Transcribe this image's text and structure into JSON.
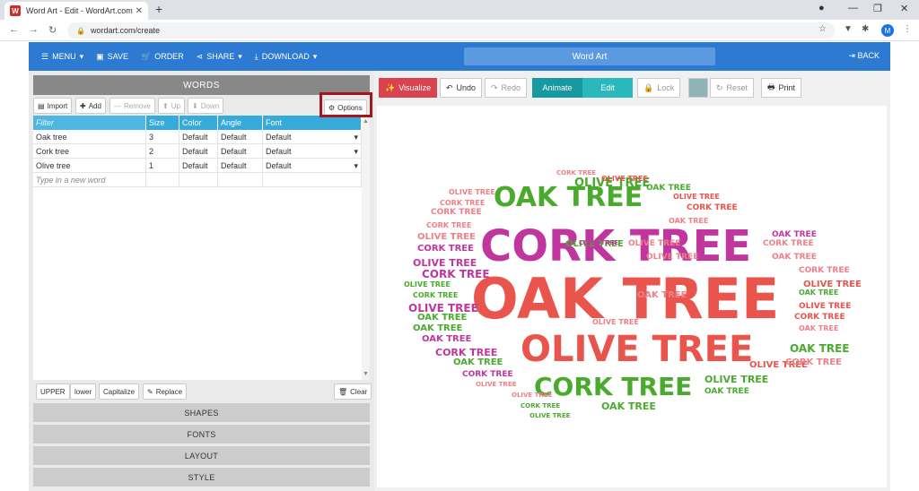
{
  "browser": {
    "tab_title": "Word Art - Edit - WordArt.com",
    "favicon": "W",
    "url": "wordart.com/create",
    "avatar": "M"
  },
  "nav": {
    "menu": "MENU",
    "save": "SAVE",
    "order": "ORDER",
    "share": "SHARE",
    "download": "DOWNLOAD",
    "title": "Word Art",
    "back": "BACK"
  },
  "words": {
    "header": "WORDS",
    "import": "Import",
    "add": "Add",
    "remove": "Remove",
    "up": "Up",
    "down": "Down",
    "options": "Options",
    "columns": {
      "filter": "Filter",
      "size": "Size",
      "color": "Color",
      "angle": "Angle",
      "font": "Font"
    },
    "rows": [
      {
        "word": "Oak tree",
        "size": "3",
        "color": "Default",
        "angle": "Default",
        "font": "Default"
      },
      {
        "word": "Cork tree",
        "size": "2",
        "color": "Default",
        "angle": "Default",
        "font": "Default"
      },
      {
        "word": "Olive tree",
        "size": "1",
        "color": "Default",
        "angle": "Default",
        "font": "Default"
      }
    ],
    "new_word_placeholder": "Type in a new word",
    "upper": "UPPER",
    "lower": "lower",
    "capitalize": "Capitalize",
    "replace": "Replace",
    "clear": "Clear"
  },
  "sections": {
    "shapes": "SHAPES",
    "fonts": "FONTS",
    "layout": "LAYOUT",
    "style": "STYLE"
  },
  "toolbar": {
    "visualize": "Visualize",
    "undo": "Undo",
    "redo": "Redo",
    "animate": "Animate",
    "edit": "Edit",
    "lock": "Lock",
    "reset": "Reset",
    "print": "Print"
  },
  "cloud": {
    "oak": "OAK TREE",
    "cork": "CORK TREE",
    "olive": "OLIVE TREE"
  },
  "colors": {
    "accent_blue": "#2c7ad1",
    "grid_blue": "#36aadb",
    "visualize_red": "#d9434f",
    "animate_teal": "#17999f",
    "edit_teal": "#2bb8bd",
    "oak_green": "#4aaa2d",
    "cork_magenta": "#c0359e",
    "olive_red": "#e9544d",
    "pink": "#f07f86"
  }
}
